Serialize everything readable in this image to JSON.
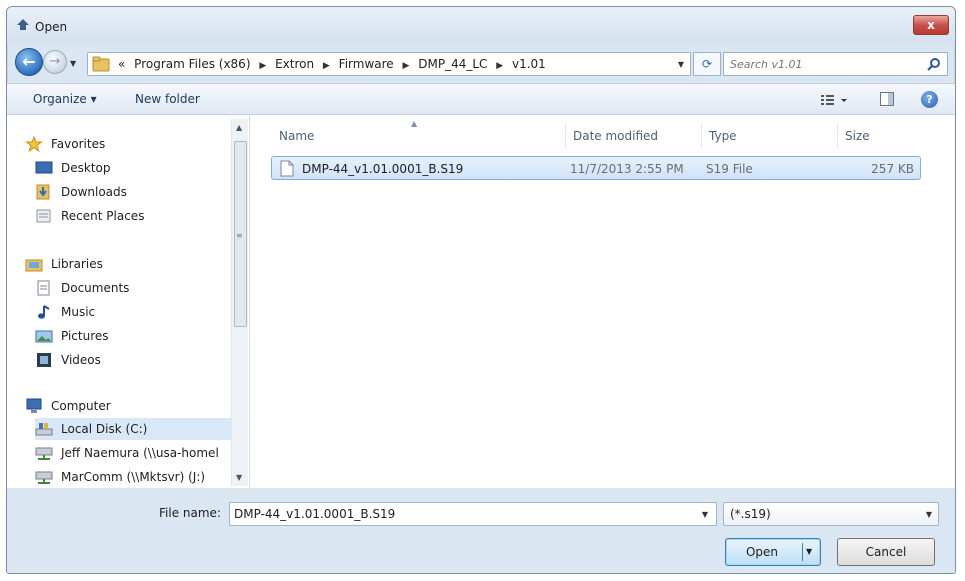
{
  "window": {
    "title": "Open",
    "close_label": "x"
  },
  "navigation": {
    "back_label": "←",
    "forward_label": "→",
    "breadcrumbs": [
      "«",
      "Program Files (x86)",
      "Extron",
      "Firmware",
      "DMP_44_LC",
      "v1.01"
    ],
    "search_placeholder": "Search v1.01"
  },
  "toolbar": {
    "organize_label": "Organize ▾",
    "new_folder_label": "New folder",
    "help_label": "?"
  },
  "sidebar": {
    "groups": [
      {
        "label": "Favorites",
        "icon": "star-icon"
      },
      {
        "label": "Libraries",
        "icon": "libraries-icon"
      },
      {
        "label": "Computer",
        "icon": "computer-icon"
      }
    ],
    "items": [
      {
        "label": "Desktop",
        "icon": "desktop-icon"
      },
      {
        "label": "Downloads",
        "icon": "downloads-icon"
      },
      {
        "label": "Recent Places",
        "icon": "recent-places-icon"
      },
      {
        "label": "Documents",
        "icon": "documents-icon"
      },
      {
        "label": "Music",
        "icon": "music-icon"
      },
      {
        "label": "Pictures",
        "icon": "pictures-icon"
      },
      {
        "label": "Videos",
        "icon": "videos-icon"
      },
      {
        "label": "Local Disk (C:)",
        "icon": "disk-icon",
        "selected": true
      },
      {
        "label": "Jeff Naemura (\\\\usa-homel",
        "icon": "network-drive-icon"
      },
      {
        "label": "MarComm (\\\\Mktsvr) (J:)",
        "icon": "network-drive-icon"
      }
    ]
  },
  "file_list": {
    "columns": [
      "Name",
      "Date modified",
      "Type",
      "Size"
    ],
    "rows": [
      {
        "name": "DMP-44_v1.01.0001_B.S19",
        "date": "11/7/2013 2:55 PM",
        "type": "S19 File",
        "size": "257 KB"
      }
    ]
  },
  "footer": {
    "filename_label": "File name:",
    "filename_value": "DMP-44_v1.01.0001_B.S19",
    "filter_value": "(*.s19)",
    "open_label": "Open",
    "cancel_label": "Cancel"
  },
  "colors": {
    "chrome": "#dbe6f3",
    "selection": "#cfe3f8",
    "close_button": "#c75050",
    "accent_blue": "#2a6fc0"
  }
}
